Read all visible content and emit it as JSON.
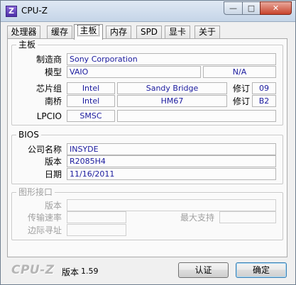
{
  "window": {
    "title": "CPU-Z",
    "icon_letter": "Z",
    "controls": {
      "minimize": "—",
      "maximize": "□",
      "close": "✕"
    }
  },
  "tabs": [
    "处理器",
    "缓存",
    "主板",
    "内存",
    "SPD",
    "显卡",
    "关于"
  ],
  "active_tab": "主板",
  "motherboard": {
    "group_title": "主板",
    "manufacturer_label": "制造商",
    "manufacturer": "Sony Corporation",
    "model_label": "模型",
    "model": "VAIO",
    "model_rev": "N/A",
    "chipset_label": "芯片组",
    "chipset_vendor": "Intel",
    "chipset_name": "Sandy Bridge",
    "chipset_rev_label": "修订",
    "chipset_rev": "09",
    "southbridge_label": "南桥",
    "southbridge_vendor": "Intel",
    "southbridge_name": "HM67",
    "southbridge_rev_label": "修订",
    "southbridge_rev": "B2",
    "lpcio_label": "LPCIO",
    "lpcio_vendor": "SMSC",
    "lpcio_name": ""
  },
  "bios": {
    "group_title": "BIOS",
    "brand_label": "公司名称",
    "brand": "INSYDE",
    "version_label": "版本",
    "version": "R2085H4",
    "date_label": "日期",
    "date": "11/16/2011"
  },
  "graphic_interface": {
    "group_title": "图形接口",
    "version_label": "版本",
    "version": "",
    "link_width_label": "传输速率",
    "link_width": "",
    "max_supported_label": "最大支持",
    "max_supported": "",
    "sideband_label": "边际寻址",
    "sideband": ""
  },
  "footer": {
    "brand": "CPU-Z",
    "version_label": "版本",
    "version": "1.59",
    "validate_label": "认证",
    "ok_label": "确定"
  }
}
